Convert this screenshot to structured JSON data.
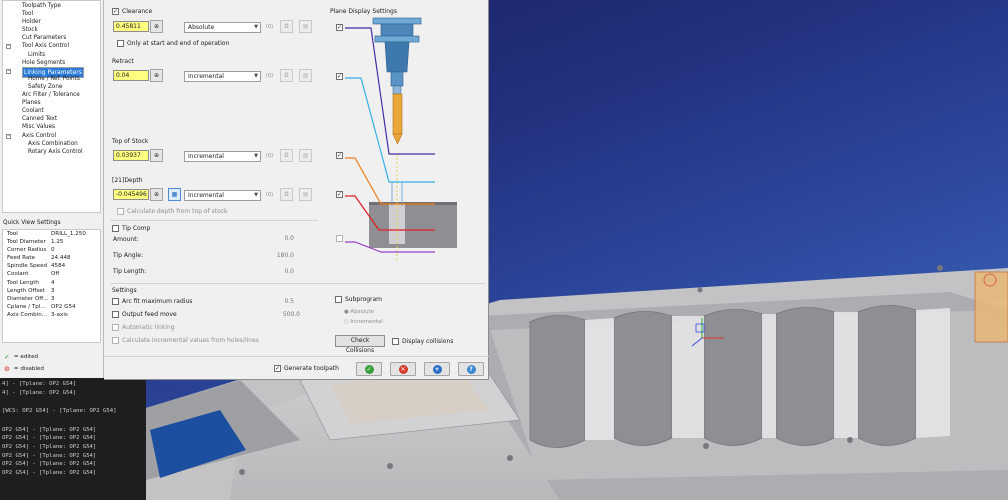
{
  "tree": {
    "items": [
      {
        "label": "Toolpath Type",
        "depth": 1
      },
      {
        "label": "Tool",
        "depth": 1
      },
      {
        "label": "Holder",
        "depth": 1
      },
      {
        "label": "Stock",
        "depth": 1
      },
      {
        "label": "Cut Parameters",
        "depth": 1
      },
      {
        "label": "Tool Axis Control",
        "depth": 1,
        "expander": "−"
      },
      {
        "label": "Limits",
        "depth": 2
      },
      {
        "label": "Hole Segments",
        "depth": 1
      },
      {
        "label": "Linking Parameters",
        "depth": 1,
        "expander": "−",
        "selected": true
      },
      {
        "label": "Home / Ref. Points",
        "depth": 2
      },
      {
        "label": "Safety Zone",
        "depth": 2
      },
      {
        "label": "Arc Filter / Tolerance",
        "depth": 1
      },
      {
        "label": "Planes",
        "depth": 1
      },
      {
        "label": "Coolant",
        "depth": 1
      },
      {
        "label": "Canned Text",
        "depth": 1
      },
      {
        "label": "Misc Values",
        "depth": 1
      },
      {
        "label": "Axis Control",
        "depth": 1,
        "expander": "−"
      },
      {
        "label": "Axis Combination",
        "depth": 2
      },
      {
        "label": "Rotary Axis Control",
        "depth": 2
      }
    ]
  },
  "quick_view": {
    "title": "Quick View Settings",
    "rows": [
      {
        "k": "Tool",
        "v": "DRILL_1.250"
      },
      {
        "k": "Tool Diameter",
        "v": "1.25"
      },
      {
        "k": "Corner Radius",
        "v": "0"
      },
      {
        "k": "Feed Rate",
        "v": "24.448"
      },
      {
        "k": "Spindle Speed",
        "v": "4584"
      },
      {
        "k": "Coolant",
        "v": "Off"
      },
      {
        "k": "Tool Length",
        "v": "4"
      },
      {
        "k": "Length Offset",
        "v": "3"
      },
      {
        "k": "Diameter Off...",
        "v": "3"
      },
      {
        "k": "Cplane / Tpl...",
        "v": "OP2 G54"
      },
      {
        "k": "Axis Combin...",
        "v": "3-axis"
      }
    ]
  },
  "legend": {
    "edited": "= edited",
    "disabled": "= disabled"
  },
  "console": {
    "lines": [
      "4] - [Tplane: OP2 G54]",
      "4] - [Tplane: OP2 G54]",
      "[WCS: OP2 G54] - [Tplane: OP2 G54]",
      "OP2 G54] - [Tplane: OP2 G54]",
      "OP2 G54] - [Tplane: OP2 G54]",
      "OP2 G54] - [Tplane: OP2 G54]",
      "OP2 G54] - [Tplane: OP2 G54]",
      "OP2 G54] - [Tplane: OP2 G54]",
      "OP2 G54] - [Tplane: OP2 G54]"
    ]
  },
  "params": {
    "clearance": {
      "label": "Clearance",
      "value": "0.45811",
      "mode": "Absolute",
      "checked": true
    },
    "only_start_end": "Only at start and end of operation",
    "retract": {
      "label": "Retract",
      "value": "0.04",
      "mode": "Incremental"
    },
    "top_of_stock": {
      "label": "Top of Stock",
      "value": "0.03937",
      "mode": "Incremental"
    },
    "depth": {
      "label": "[21]Depth",
      "value": "-0.045496",
      "mode": "Incremental"
    },
    "calc_depth": "Calculate depth from top of stock",
    "tip_comp": {
      "label": "Tip Comp",
      "amount_label": "Amount:",
      "amount": "0.0",
      "angle_label": "Tip Angle:",
      "angle": "180.0",
      "length_label": "Tip Length:",
      "length": "0.0"
    },
    "settings": {
      "title": "Settings",
      "arc_fit": "Arc fit maximum radius",
      "arc_fit_value": "0.5",
      "output_feed": "Output feed move",
      "output_feed_value": "500.0",
      "auto_link": "Automatic linking",
      "calc_incremental": "Calculate incremental values from holes/lines"
    },
    "subprogram": {
      "label": "Subprogram",
      "absolute": "Absolute",
      "incremental": "Incremental"
    },
    "check_collisions": "Check Collisions",
    "display_collisions": "Display collisions",
    "generate_toolpath": "Generate toolpath",
    "plane_display_title": "Plane Display Settings",
    "small_zero": "(0)",
    "check_mark": "✓",
    "colors": {
      "clearance": "#4b2ba8",
      "retract": "#35aee8",
      "top_of_stock": "#f07d1c",
      "depth": "#e01c26",
      "extra": "#9a3fc8",
      "input_bg": "#ffff80",
      "selected": "#2b7ad9",
      "ok": "#3aa03a",
      "cancel": "#d63a2a",
      "add": "#2d6fc4",
      "help": "#3b88d4"
    },
    "icons": {
      "lock": "lock-icon",
      "calc": "calculator-icon",
      "ok": "checkmark-icon",
      "cancel": "cancel-icon",
      "add": "plus-icon",
      "help": "help-icon",
      "edited": "check-icon",
      "disabled": "no-entry-icon"
    }
  }
}
